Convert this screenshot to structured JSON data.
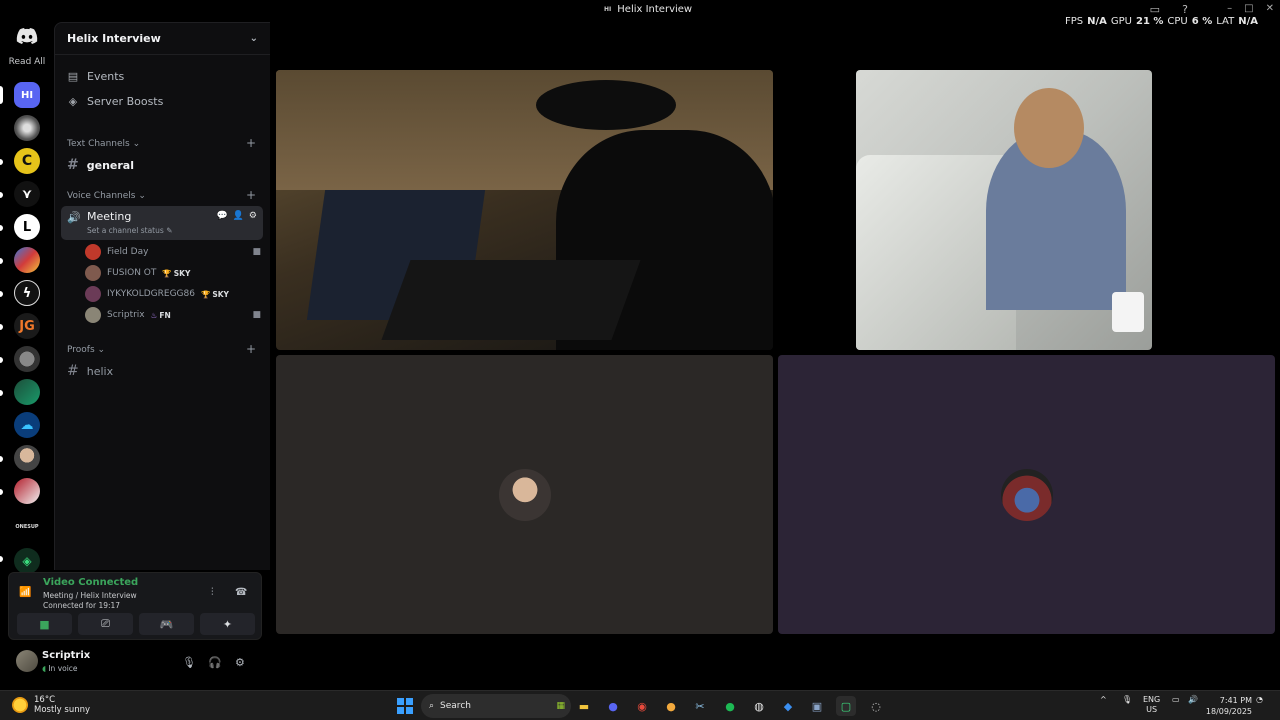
{
  "window": {
    "title": "Helix Interview",
    "app_icon_text": "HI"
  },
  "overlay": {
    "fps_label": "FPS",
    "fps_value": "N/A",
    "gpu_label": "GPU",
    "gpu_value": "21",
    "cpu_label": "CPU",
    "cpu_value": "6",
    "percent_sign": "%",
    "lat_label": "LAT",
    "lat_value": "N/A"
  },
  "rail": {
    "read_all": "Read All",
    "active_server": "HI",
    "jg_label": "JG",
    "onesup_label": "ONESUP"
  },
  "guild": {
    "name": "Helix Interview",
    "events": "Events",
    "server_boosts": "Server Boosts",
    "text_category": "Text Channels",
    "text_channel": "general",
    "voice_category": "Voice Channels",
    "voice_channel": "Meeting",
    "voice_status_placeholder": "Set a channel status",
    "proofs_category": "Proofs",
    "proofs_channel": "helix",
    "members": [
      {
        "name": "Field Day",
        "tag": "",
        "color": "#c0392b"
      },
      {
        "name": "FUSION OT",
        "tag": "SKY",
        "color": "#7f5a4e"
      },
      {
        "name": "IYKYKOLDGREGG86",
        "tag": "SKY",
        "color": "#6b3b57"
      },
      {
        "name": "Scriptrix",
        "tag": "FN",
        "color": "#8a8576"
      }
    ]
  },
  "voice_panel": {
    "status": "Video Connected",
    "location": "Meeting / Helix Interview",
    "duration": "Connected for 19:17"
  },
  "user": {
    "name": "Scriptrix",
    "status": "In voice"
  },
  "taskbar": {
    "temp": "16°C",
    "condition": "Mostly sunny",
    "search_placeholder": "Search",
    "lang": "ENG",
    "region": "US",
    "time": "7:41 PM",
    "date": "18/09/2025"
  },
  "colors": {
    "accent": "#5865f2",
    "green": "#3ba55c",
    "sidebar": "#0e0e10"
  }
}
